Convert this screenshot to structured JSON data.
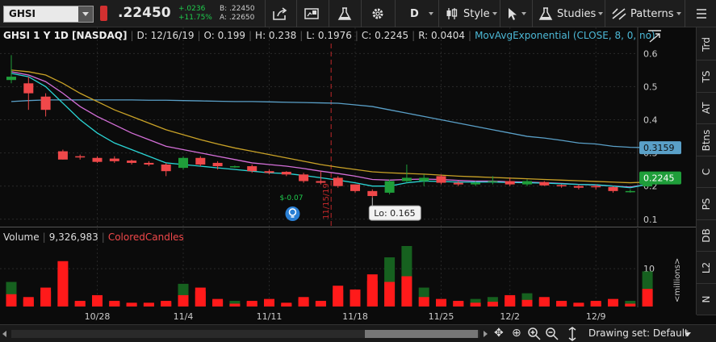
{
  "toolbar": {
    "symbol": "GHSI",
    "last": ".22450",
    "change_abs": "+.0236",
    "change_pct": "+11.75%",
    "bid": "B: .22450",
    "ask": "A: .22650",
    "interval_label": "D",
    "style_label": "Style",
    "studies_label": "Studies",
    "patterns_label": "Patterns"
  },
  "header": {
    "title": "GHSI 1 Y 1D [NASDAQ]",
    "date": "D: 12/16/19",
    "open": "O: 0.199",
    "high": "H: 0.238",
    "low": "L: 0.1976",
    "close": "C: 0.2245",
    "range": "R: 0.0404",
    "study": "MovAvgExponential (CLOSE, 8, 0, no)"
  },
  "volume_header": {
    "label": "Volume",
    "value": "9,326,983",
    "study": "ColoredCandles"
  },
  "right_tabs": [
    "Trd",
    "TS",
    "AT",
    "Btns",
    "C",
    "PS",
    "DB",
    "L2",
    "N"
  ],
  "bottom": {
    "drawing_set": "Drawing set: Default"
  },
  "colors": {
    "up": "#1f9e3a",
    "down": "#f0484a",
    "ema_short": "#2ad4d4",
    "ema_mid": "#d46fd8",
    "ema_long": "#c9a227",
    "sma_long": "#5aa0c8",
    "vol_up": "#16611f",
    "vol_down": "#ff1a1a"
  },
  "chart_data": {
    "type": "candlestick",
    "price_axis": {
      "ticks": [
        0.1,
        0.2,
        0.3,
        0.4,
        0.5,
        0.6
      ],
      "ylim": [
        0.08,
        0.63
      ]
    },
    "volume_axis": {
      "ticks": [
        10
      ],
      "ylim": [
        0,
        16
      ],
      "label": "<millions>"
    },
    "x_labels": [
      {
        "index": 5,
        "label": "10/28"
      },
      {
        "index": 10,
        "label": "11/4"
      },
      {
        "index": 15,
        "label": "11/11"
      },
      {
        "index": 20,
        "label": "11/18"
      },
      {
        "index": 25,
        "label": "11/25"
      },
      {
        "index": 29,
        "label": "12/2"
      },
      {
        "index": 34,
        "label": "12/9"
      }
    ],
    "candles": [
      {
        "o": 0.52,
        "h": 0.595,
        "l": 0.51,
        "c": 0.53,
        "v": 6.5
      },
      {
        "o": 0.51,
        "h": 0.53,
        "l": 0.43,
        "c": 0.48,
        "v": 2.5
      },
      {
        "o": 0.47,
        "h": 0.48,
        "l": 0.41,
        "c": 0.43,
        "v": 5.0
      },
      {
        "o": 0.305,
        "h": 0.31,
        "l": 0.28,
        "c": 0.28,
        "v": 12.0
      },
      {
        "o": 0.29,
        "h": 0.295,
        "l": 0.28,
        "c": 0.287,
        "v": 1.5
      },
      {
        "o": 0.285,
        "h": 0.29,
        "l": 0.27,
        "c": 0.273,
        "v": 3.0
      },
      {
        "o": 0.283,
        "h": 0.29,
        "l": 0.27,
        "c": 0.275,
        "v": 1.5
      },
      {
        "o": 0.277,
        "h": 0.28,
        "l": 0.265,
        "c": 0.27,
        "v": 1.0
      },
      {
        "o": 0.27,
        "h": 0.275,
        "l": 0.26,
        "c": 0.265,
        "v": 1.0
      },
      {
        "o": 0.265,
        "h": 0.27,
        "l": 0.23,
        "c": 0.245,
        "v": 1.5
      },
      {
        "o": 0.255,
        "h": 0.29,
        "l": 0.25,
        "c": 0.285,
        "v": 6.0
      },
      {
        "o": 0.285,
        "h": 0.29,
        "l": 0.26,
        "c": 0.265,
        "v": 5.0
      },
      {
        "o": 0.27,
        "h": 0.275,
        "l": 0.25,
        "c": 0.26,
        "v": 2.0
      },
      {
        "o": 0.257,
        "h": 0.262,
        "l": 0.255,
        "c": 0.26,
        "v": 1.5
      },
      {
        "o": 0.26,
        "h": 0.265,
        "l": 0.24,
        "c": 0.245,
        "v": 1.5
      },
      {
        "o": 0.245,
        "h": 0.25,
        "l": 0.235,
        "c": 0.24,
        "v": 2.0
      },
      {
        "o": 0.243,
        "h": 0.245,
        "l": 0.23,
        "c": 0.235,
        "v": 1.0
      },
      {
        "o": 0.235,
        "h": 0.24,
        "l": 0.21,
        "c": 0.215,
        "v": 2.5
      },
      {
        "o": 0.215,
        "h": 0.245,
        "l": 0.205,
        "c": 0.21,
        "v": 1.5
      },
      {
        "o": 0.225,
        "h": 0.23,
        "l": 0.195,
        "c": 0.2,
        "v": 5.5
      },
      {
        "o": 0.205,
        "h": 0.205,
        "l": 0.18,
        "c": 0.185,
        "v": 4.5
      },
      {
        "o": 0.185,
        "h": 0.19,
        "l": 0.165,
        "c": 0.17,
        "v": 8.5
      },
      {
        "o": 0.18,
        "h": 0.22,
        "l": 0.175,
        "c": 0.215,
        "v": 13.0
      },
      {
        "o": 0.215,
        "h": 0.265,
        "l": 0.21,
        "c": 0.225,
        "v": 16.0
      },
      {
        "o": 0.215,
        "h": 0.235,
        "l": 0.2,
        "c": 0.225,
        "v": 5.0
      },
      {
        "o": 0.23,
        "h": 0.235,
        "l": 0.205,
        "c": 0.21,
        "v": 2.0
      },
      {
        "o": 0.21,
        "h": 0.215,
        "l": 0.2,
        "c": 0.205,
        "v": 1.5
      },
      {
        "o": 0.205,
        "h": 0.215,
        "l": 0.2,
        "c": 0.21,
        "v": 2.0
      },
      {
        "o": 0.212,
        "h": 0.23,
        "l": 0.205,
        "c": 0.215,
        "v": 2.5
      },
      {
        "o": 0.215,
        "h": 0.225,
        "l": 0.2,
        "c": 0.205,
        "v": 3.0
      },
      {
        "o": 0.205,
        "h": 0.22,
        "l": 0.2,
        "c": 0.215,
        "v": 3.5
      },
      {
        "o": 0.212,
        "h": 0.215,
        "l": 0.2,
        "c": 0.202,
        "v": 2.5
      },
      {
        "o": 0.203,
        "h": 0.205,
        "l": 0.195,
        "c": 0.2,
        "v": 1.5
      },
      {
        "o": 0.2,
        "h": 0.205,
        "l": 0.19,
        "c": 0.195,
        "v": 1.0
      },
      {
        "o": 0.2,
        "h": 0.205,
        "l": 0.19,
        "c": 0.198,
        "v": 1.5
      },
      {
        "o": 0.197,
        "h": 0.2,
        "l": 0.18,
        "c": 0.185,
        "v": 2.0
      },
      {
        "o": 0.185,
        "h": 0.19,
        "l": 0.18,
        "c": 0.185,
        "v": 1.5
      },
      {
        "o": 0.199,
        "h": 0.238,
        "l": 0.1976,
        "c": 0.2245,
        "v": 9.3
      }
    ],
    "ema_short": [
      0.54,
      0.53,
      0.5,
      0.45,
      0.4,
      0.36,
      0.33,
      0.31,
      0.29,
      0.27,
      0.265,
      0.26,
      0.255,
      0.25,
      0.245,
      0.24,
      0.238,
      0.232,
      0.225,
      0.218,
      0.21,
      0.2,
      0.2,
      0.21,
      0.215,
      0.214,
      0.212,
      0.212,
      0.212,
      0.211,
      0.21,
      0.209,
      0.207,
      0.205,
      0.204,
      0.2,
      0.195,
      0.205
    ],
    "ema_mid": [
      0.545,
      0.535,
      0.515,
      0.48,
      0.44,
      0.41,
      0.385,
      0.36,
      0.34,
      0.32,
      0.31,
      0.3,
      0.29,
      0.28,
      0.27,
      0.265,
      0.26,
      0.253,
      0.245,
      0.238,
      0.23,
      0.22,
      0.218,
      0.22,
      0.221,
      0.22,
      0.217,
      0.215,
      0.215,
      0.213,
      0.212,
      0.21,
      0.208,
      0.205,
      0.203,
      0.2,
      0.197,
      0.205
    ],
    "ema_long": [
      0.55,
      0.545,
      0.535,
      0.51,
      0.48,
      0.455,
      0.43,
      0.41,
      0.39,
      0.37,
      0.355,
      0.34,
      0.327,
      0.315,
      0.305,
      0.295,
      0.285,
      0.275,
      0.265,
      0.257,
      0.25,
      0.243,
      0.24,
      0.238,
      0.236,
      0.233,
      0.23,
      0.228,
      0.226,
      0.224,
      0.222,
      0.22,
      0.218,
      0.216,
      0.214,
      0.212,
      0.21,
      0.212
    ],
    "sma_long": [
      0.455,
      0.458,
      0.46,
      0.46,
      0.46,
      0.46,
      0.46,
      0.46,
      0.459,
      0.459,
      0.458,
      0.457,
      0.456,
      0.455,
      0.455,
      0.454,
      0.453,
      0.452,
      0.451,
      0.45,
      0.445,
      0.44,
      0.43,
      0.42,
      0.41,
      0.4,
      0.39,
      0.38,
      0.37,
      0.36,
      0.35,
      0.345,
      0.338,
      0.33,
      0.327,
      0.32,
      0.317,
      0.3159
    ],
    "price_badges": [
      {
        "value": 0.3159,
        "label": "0.3159",
        "color": "#5aa0c8"
      },
      {
        "value": 0.2245,
        "label": "0.2245",
        "color": "#1f9e3a"
      }
    ],
    "annotations": {
      "low_callout": "Lo: 0.165",
      "low_index": 21,
      "event_label": "$-0.07",
      "vertical_line_label": "11/15/19",
      "vertical_line_index": 18.6
    }
  }
}
